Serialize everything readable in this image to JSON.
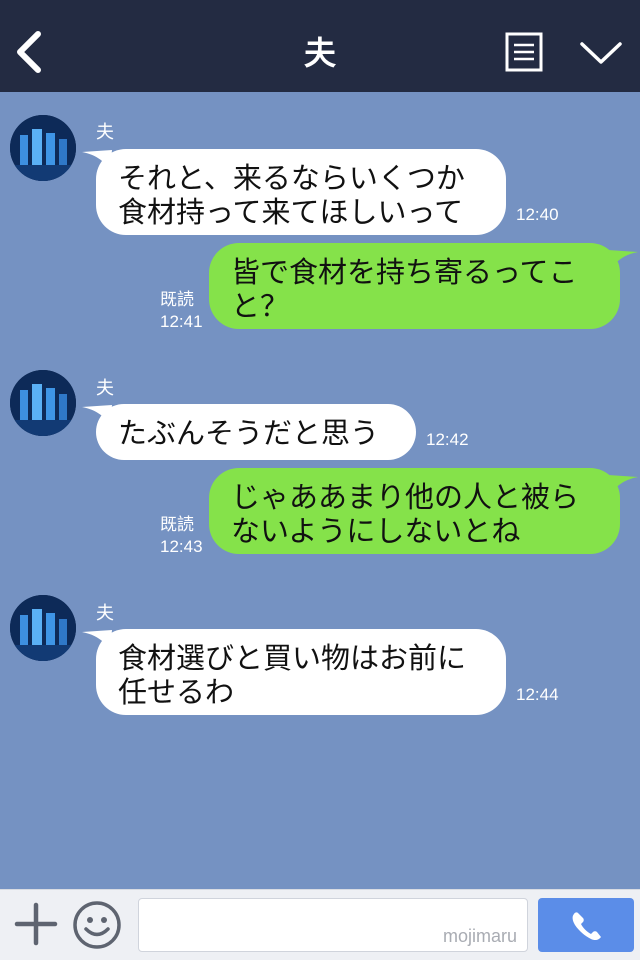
{
  "header": {
    "title": "夫"
  },
  "messages": [
    {
      "sender": "夫",
      "text": "それと、来るならいくつか\n食材持って来てほしいって",
      "time": "12:40"
    },
    {
      "text": "皆で食材を持ち寄るってこ\nと？",
      "read": "既読",
      "time": "12:41"
    },
    {
      "sender": "夫",
      "text": "たぶんそうだと思う",
      "time": "12:42"
    },
    {
      "text": "じゃああまり他の人と被ら\nないようにしないとね",
      "read": "既読",
      "time": "12:43"
    },
    {
      "sender": "夫",
      "text": "食材選びと買い物はお前に\n任せるわ",
      "time": "12:44"
    }
  ],
  "footer": {
    "watermark": "mojimaru"
  },
  "colors": {
    "header_bg": "#232b42",
    "chat_bg": "#7592c2",
    "incoming_bubble": "#ffffff",
    "outgoing_bubble": "#85e24a",
    "call_button": "#5b8de8"
  },
  "icons": [
    "back-icon",
    "memo-icon",
    "chevron-down-icon",
    "plus-icon",
    "smile-icon",
    "phone-icon"
  ]
}
